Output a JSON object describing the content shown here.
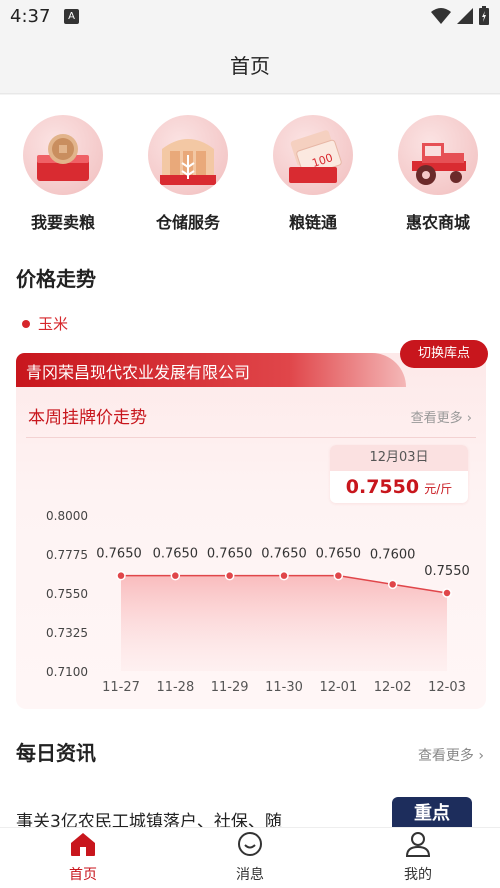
{
  "status": {
    "time": "4:37",
    "a_icon": "A"
  },
  "nav": {
    "title": "首页"
  },
  "quick": [
    {
      "label": "我要卖粮",
      "icon": "coin-wallet-icon"
    },
    {
      "label": "仓储服务",
      "icon": "grain-silo-icon"
    },
    {
      "label": "粮链通",
      "icon": "money-ticket-icon"
    },
    {
      "label": "惠农商城",
      "icon": "tractor-icon"
    }
  ],
  "price": {
    "title": "价格走势",
    "crop": "玉米",
    "company": "青冈荣昌现代农业发展有限公司",
    "switch_label": "切换库点",
    "subtitle": "本周挂牌价走势",
    "more_label": "查看更多 ›",
    "tooltip": {
      "date": "12月03日",
      "value": "0.7550",
      "unit": "元/斤"
    }
  },
  "chart_data": {
    "type": "area",
    "categories": [
      "11-27",
      "11-28",
      "11-29",
      "11-30",
      "12-01",
      "12-02",
      "12-03"
    ],
    "values": [
      0.765,
      0.765,
      0.765,
      0.765,
      0.765,
      0.76,
      0.755
    ],
    "value_labels": [
      "0.7650",
      "0.7650",
      "0.7650",
      "0.7650",
      "0.7650",
      "0.7600",
      "0.7550"
    ],
    "y_ticks": [
      "0.8000",
      "0.7775",
      "0.7550",
      "0.7325",
      "0.7100"
    ],
    "ylim": [
      0.71,
      0.8
    ],
    "color": "#e0464a"
  },
  "news": {
    "title": "每日资讯",
    "more_label": "查看更多 ›",
    "first_headline": "事关3亿农民工城镇落户、社保、随",
    "thumb_text": "重点"
  },
  "tabs": [
    {
      "label": "首页",
      "icon": "home-icon",
      "active": true
    },
    {
      "label": "消息",
      "icon": "message-icon",
      "active": false
    },
    {
      "label": "我的",
      "icon": "user-icon",
      "active": false
    }
  ],
  "colors": {
    "accent": "#c8161d",
    "muted": "#888888"
  }
}
